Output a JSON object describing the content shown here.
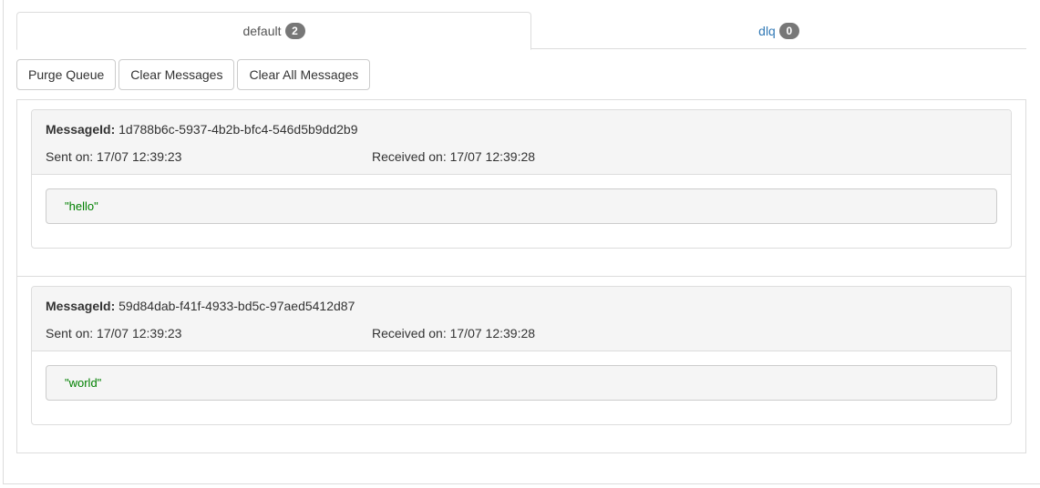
{
  "tabs": [
    {
      "label": "default",
      "count": "2",
      "active": true
    },
    {
      "label": "dlq",
      "count": "0",
      "active": false
    }
  ],
  "toolbar": {
    "purge_label": "Purge Queue",
    "clear_label": "Clear Messages",
    "clear_all_label": "Clear All Messages"
  },
  "messages": [
    {
      "id_label": "MessageId:",
      "id": "1d788b6c-5937-4b2b-bfc4-546d5b9dd2b9",
      "sent": "Sent on: 17/07 12:39:23",
      "received": "Received on: 17/07 12:39:28",
      "payload": "\"hello\""
    },
    {
      "id_label": "MessageId:",
      "id": "59d84dab-f41f-4933-bd5c-97aed5412d87",
      "sent": "Sent on: 17/07 12:39:23",
      "received": "Received on: 17/07 12:39:28",
      "payload": "\"world\""
    }
  ],
  "colors": {
    "link": "#337ab7",
    "badge": "#777777",
    "payload_text": "#008000"
  }
}
